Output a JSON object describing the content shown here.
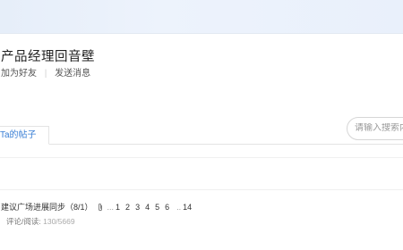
{
  "group": {
    "title": "产品经理回音壁",
    "add_friend": "加为好友",
    "send_message": "发送消息"
  },
  "tabs": {
    "active_label": "Ta的帖子"
  },
  "search": {
    "placeholder": "请输入搜索内容"
  },
  "posts": [
    {
      "title": "建议广场进展同步（8/1）",
      "ellipsis_before": "...",
      "pages": [
        "1",
        "2",
        "3",
        "4",
        "5",
        "6"
      ],
      "ellipsis_after": "..",
      "last_page": "14",
      "stats_label": "评论/阅读:",
      "stats_value": "130/5669"
    }
  ]
}
